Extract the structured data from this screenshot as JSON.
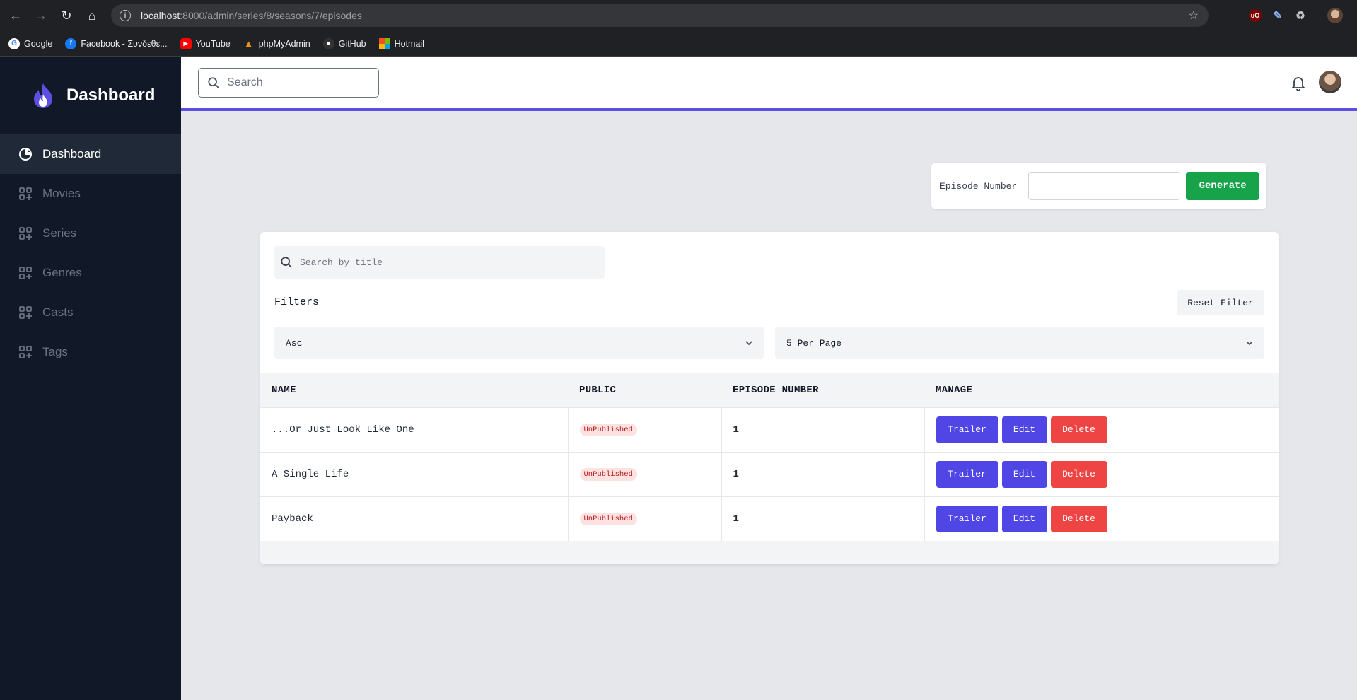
{
  "browser": {
    "url_host": "localhost",
    "url_path": ":8000/admin/series/8/seasons/7/episodes",
    "bookmarks": [
      {
        "label": "Google",
        "icon": "google-icon"
      },
      {
        "label": "Facebook - Συνδεθε...",
        "icon": "facebook-icon"
      },
      {
        "label": "YouTube",
        "icon": "youtube-icon"
      },
      {
        "label": "phpMyAdmin",
        "icon": "phpmyadmin-icon"
      },
      {
        "label": "GitHub",
        "icon": "github-icon"
      },
      {
        "label": "Hotmail",
        "icon": "hotmail-icon"
      }
    ]
  },
  "sidebar": {
    "title": "Dashboard",
    "items": [
      {
        "label": "Dashboard",
        "icon": "pie-chart-icon",
        "active": true
      },
      {
        "label": "Movies",
        "icon": "grid-plus-icon",
        "active": false
      },
      {
        "label": "Series",
        "icon": "grid-plus-icon",
        "active": false
      },
      {
        "label": "Genres",
        "icon": "grid-plus-icon",
        "active": false
      },
      {
        "label": "Casts",
        "icon": "grid-plus-icon",
        "active": false
      },
      {
        "label": "Tags",
        "icon": "grid-plus-icon",
        "active": false
      }
    ]
  },
  "header": {
    "search_placeholder": "Search"
  },
  "generate": {
    "label": "Episode Number",
    "value": "",
    "button": "Generate"
  },
  "table": {
    "search_placeholder": "Search by title",
    "filters_label": "Filters",
    "reset_label": "Reset Filter",
    "order_value": "Asc",
    "per_page_value": "5 Per Page",
    "columns": [
      "NAME",
      "PUBLIC",
      "EPISODE NUMBER",
      "MANAGE"
    ],
    "rows": [
      {
        "name": "...Or Just Look Like One",
        "public": "UnPublished",
        "episode": "1"
      },
      {
        "name": "A Single Life",
        "public": "UnPublished",
        "episode": "1"
      },
      {
        "name": "Payback",
        "public": "UnPublished",
        "episode": "1"
      }
    ],
    "actions": {
      "trailer": "Trailer",
      "edit": "Edit",
      "delete": "Delete"
    }
  },
  "colors": {
    "accent": "#4f46e5",
    "success": "#16a34a",
    "danger": "#ef4444",
    "sidebar_bg": "#111827"
  }
}
